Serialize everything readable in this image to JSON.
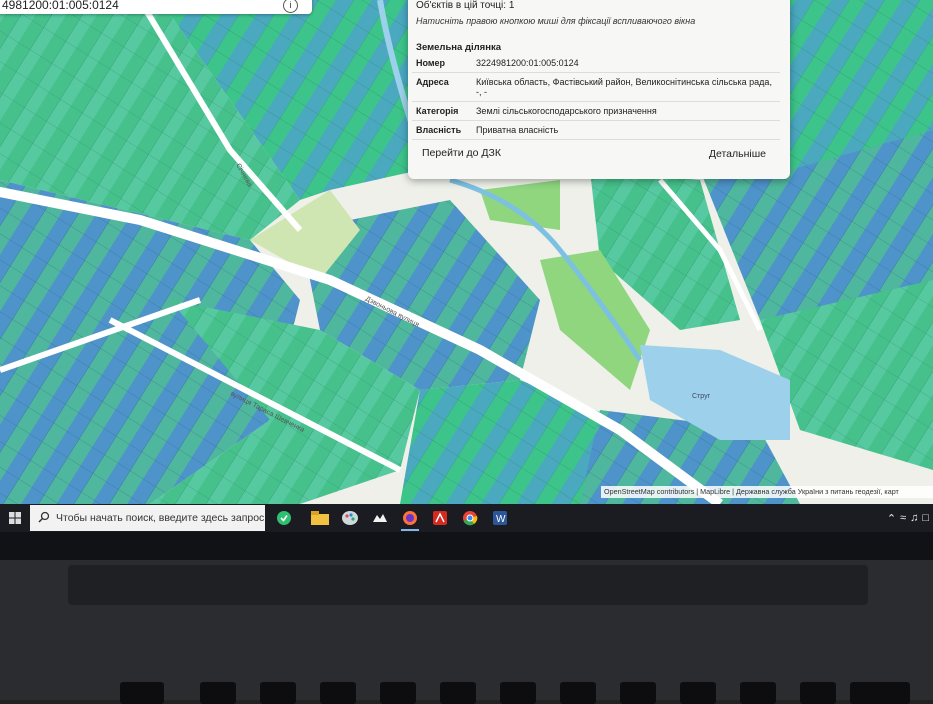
{
  "search": {
    "value": "4981200:01:005:0124",
    "info_icon": "info-icon"
  },
  "popup": {
    "count_text": "Об'єктів в цій точці: 1",
    "hint": "Натисніть правою кнопкою миші для фіксації вспливаючого вікна",
    "section_title": "Земельна ділянка",
    "fields": [
      {
        "key": "Номер",
        "value": "3224981200:01:005:0124"
      },
      {
        "key": "Адреса",
        "value": "Київська область, Фастівський район, Великоснітинська сільська рада, -, -"
      },
      {
        "key": "Категорія",
        "value": "Землі сільськогосподарського призначення"
      },
      {
        "key": "Власність",
        "value": "Приватна власність"
      }
    ],
    "btn_dzk": "Перейти до ДЗК",
    "btn_details": "Детальніше"
  },
  "map": {
    "streets": [
      "Дзвоньова вулиця",
      "вулиця Тараса Шевченка",
      "Січнева",
      "Струг"
    ],
    "colors": {
      "parcel_green": "#3fc78c",
      "parcel_teal": "#5bbfa6",
      "parcel_blue": "#4f8fcf",
      "water": "#9dd0ea",
      "park": "#8fd67f",
      "road": "#ffffff"
    }
  },
  "attribution": "OpenStreetMap contributors | MapLibre | Державна служба України з питань геодезії, карт",
  "taskbar": {
    "search_placeholder": "Чтобы начать поиск, введите здесь запрос",
    "icons": [
      "start-windows-icon",
      "search-icon",
      "app-green-icon",
      "file-explorer-icon",
      "paint-icon",
      "cloud-icon",
      "firefox-icon",
      "acrobat-icon",
      "chrome-icon",
      "word-icon"
    ]
  }
}
